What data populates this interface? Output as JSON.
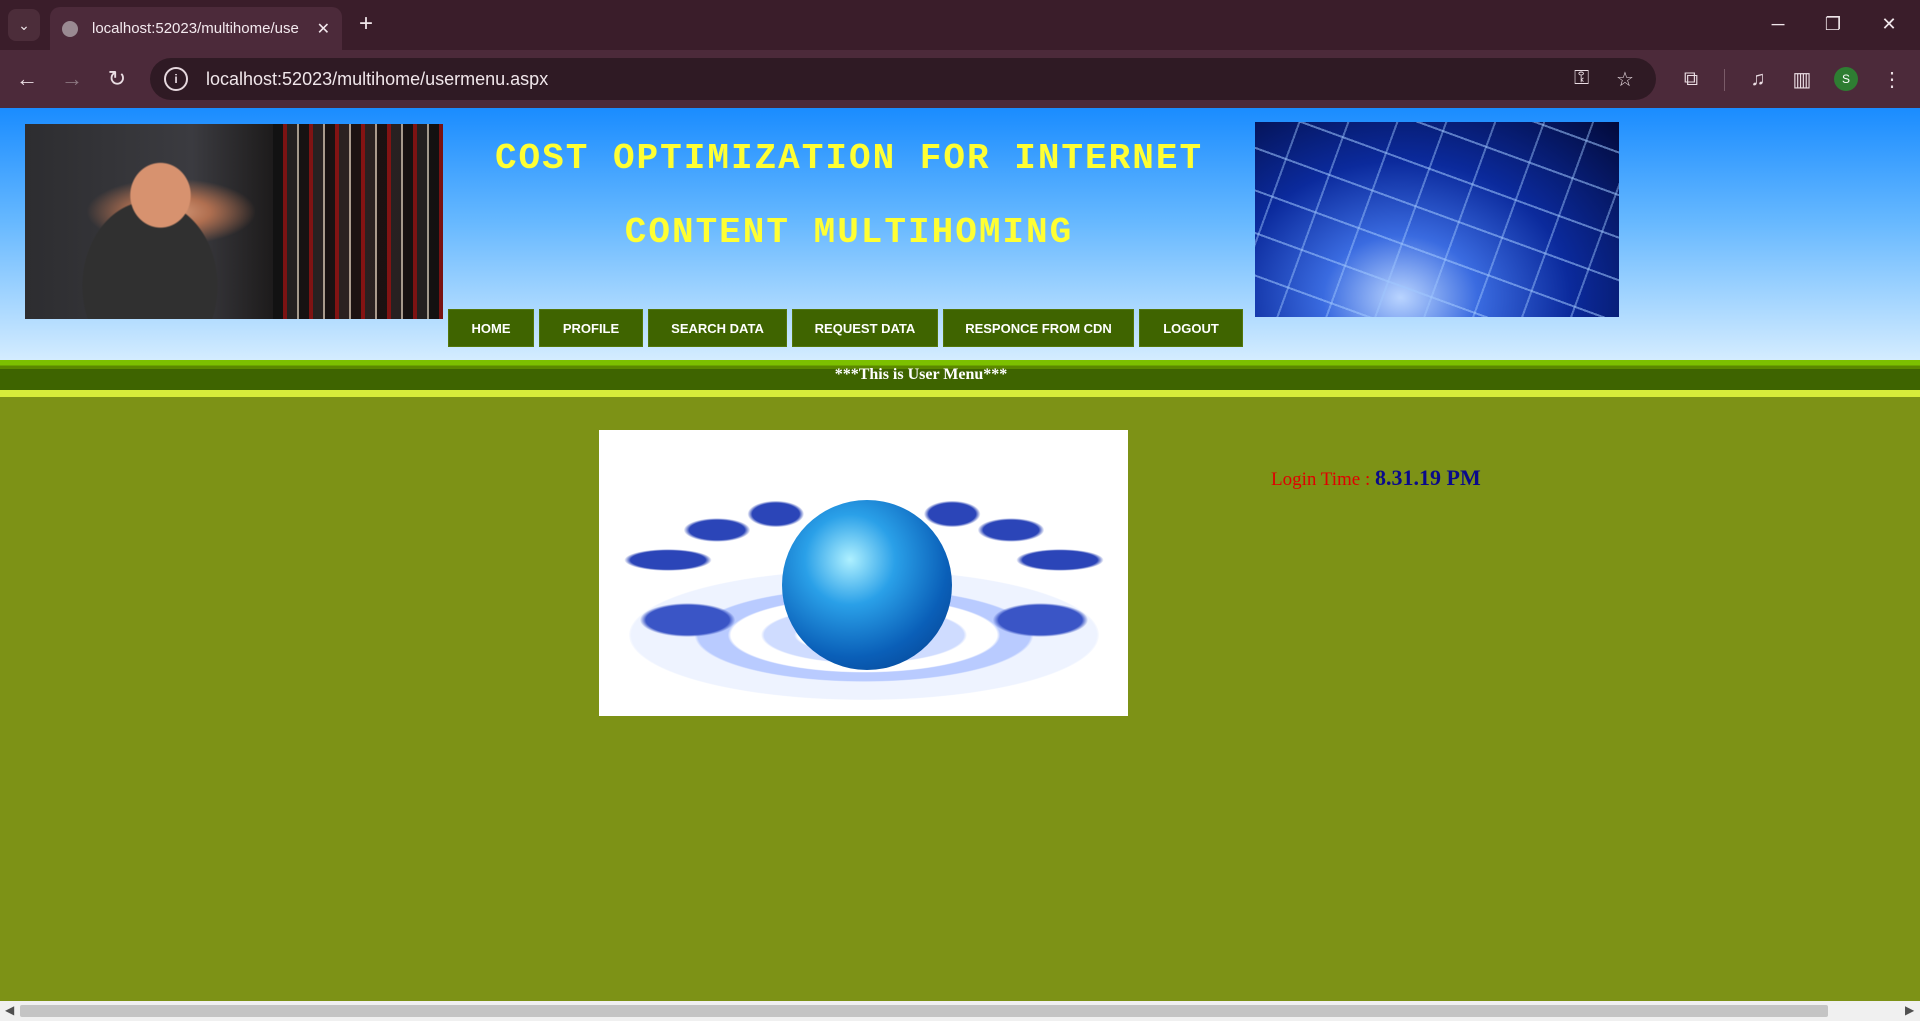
{
  "browser": {
    "tab_title": "localhost:52023/multihome/use",
    "tab_close": "✕",
    "new_tab": "+",
    "url": "localhost:52023/multihome/usermenu.aspx",
    "profile_initial": "S",
    "window_controls": {
      "minimize": "─",
      "restore": "❐",
      "close": "✕"
    },
    "nav": {
      "back": "←",
      "forward": "→",
      "reload": "↻"
    }
  },
  "header": {
    "title_line1": "COST OPTIMIZATION FOR INTERNET",
    "title_line2": "CONTENT MULTIHOMING"
  },
  "menu": {
    "items": [
      {
        "label": "HOME"
      },
      {
        "label": "PROFILE"
      },
      {
        "label": "SEARCH DATA"
      },
      {
        "label": "REQUEST DATA"
      },
      {
        "label": "RESPONCE FROM CDN"
      },
      {
        "label": "LOGOUT"
      }
    ]
  },
  "banner": {
    "text": "***This is User Menu***"
  },
  "login": {
    "label": "Login Time : ",
    "value": "8.31.19 PM"
  },
  "colors": {
    "title_yellow": "#ffff33",
    "menu_green": "#3f6400",
    "content_olive": "#7d9216",
    "login_label": "#e00000",
    "login_value": "#0a0a8a"
  }
}
